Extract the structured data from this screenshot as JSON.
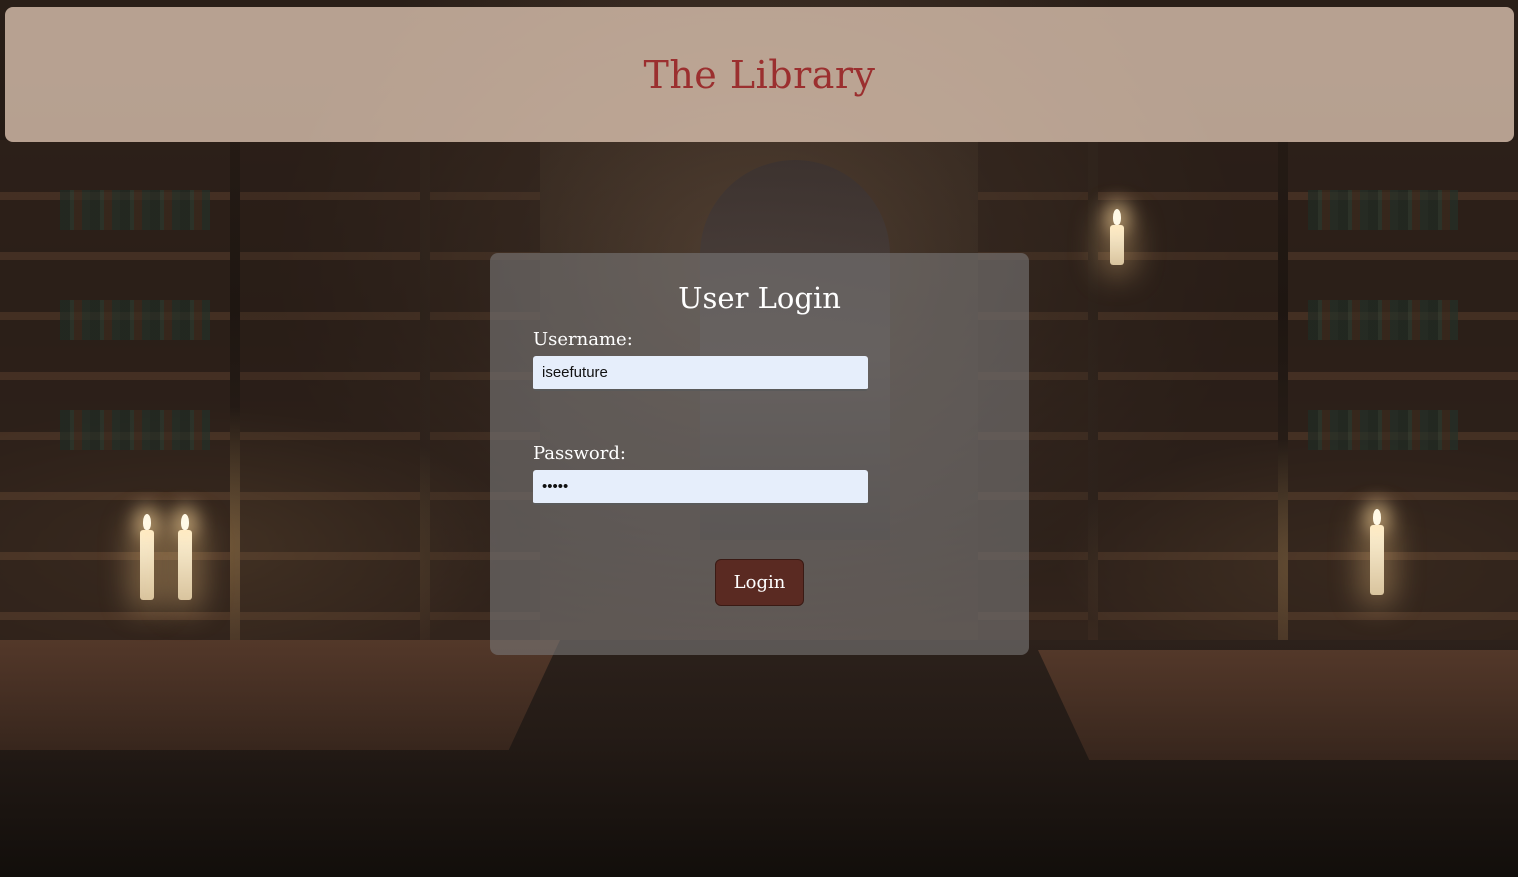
{
  "header": {
    "title": "The Library"
  },
  "login": {
    "title": "User Login",
    "username_label": "Username:",
    "username_value": "iseefuture",
    "password_label": "Password:",
    "password_value": "•••••",
    "button_label": "Login"
  },
  "colors": {
    "title_color": "#9b2f2f",
    "button_background": "#5a2a22",
    "input_background": "#e6eefb"
  }
}
